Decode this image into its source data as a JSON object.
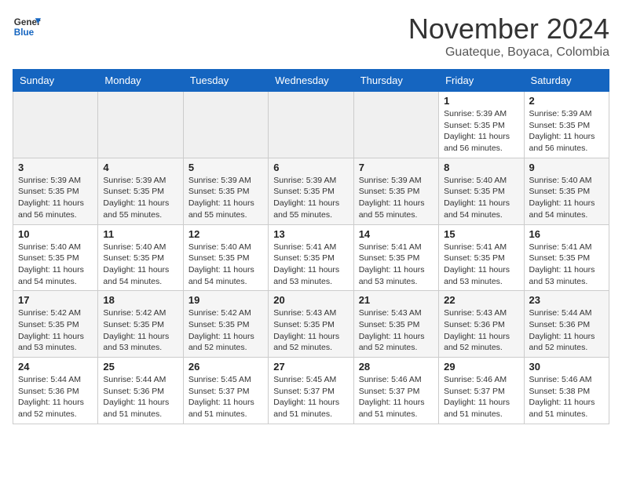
{
  "header": {
    "logo_line1": "General",
    "logo_line2": "Blue",
    "month": "November 2024",
    "location": "Guateque, Boyaca, Colombia"
  },
  "weekdays": [
    "Sunday",
    "Monday",
    "Tuesday",
    "Wednesday",
    "Thursday",
    "Friday",
    "Saturday"
  ],
  "weeks": [
    [
      {
        "day": "",
        "info": ""
      },
      {
        "day": "",
        "info": ""
      },
      {
        "day": "",
        "info": ""
      },
      {
        "day": "",
        "info": ""
      },
      {
        "day": "",
        "info": ""
      },
      {
        "day": "1",
        "info": "Sunrise: 5:39 AM\nSunset: 5:35 PM\nDaylight: 11 hours and 56 minutes."
      },
      {
        "day": "2",
        "info": "Sunrise: 5:39 AM\nSunset: 5:35 PM\nDaylight: 11 hours and 56 minutes."
      }
    ],
    [
      {
        "day": "3",
        "info": "Sunrise: 5:39 AM\nSunset: 5:35 PM\nDaylight: 11 hours and 56 minutes."
      },
      {
        "day": "4",
        "info": "Sunrise: 5:39 AM\nSunset: 5:35 PM\nDaylight: 11 hours and 55 minutes."
      },
      {
        "day": "5",
        "info": "Sunrise: 5:39 AM\nSunset: 5:35 PM\nDaylight: 11 hours and 55 minutes."
      },
      {
        "day": "6",
        "info": "Sunrise: 5:39 AM\nSunset: 5:35 PM\nDaylight: 11 hours and 55 minutes."
      },
      {
        "day": "7",
        "info": "Sunrise: 5:39 AM\nSunset: 5:35 PM\nDaylight: 11 hours and 55 minutes."
      },
      {
        "day": "8",
        "info": "Sunrise: 5:40 AM\nSunset: 5:35 PM\nDaylight: 11 hours and 54 minutes."
      },
      {
        "day": "9",
        "info": "Sunrise: 5:40 AM\nSunset: 5:35 PM\nDaylight: 11 hours and 54 minutes."
      }
    ],
    [
      {
        "day": "10",
        "info": "Sunrise: 5:40 AM\nSunset: 5:35 PM\nDaylight: 11 hours and 54 minutes."
      },
      {
        "day": "11",
        "info": "Sunrise: 5:40 AM\nSunset: 5:35 PM\nDaylight: 11 hours and 54 minutes."
      },
      {
        "day": "12",
        "info": "Sunrise: 5:40 AM\nSunset: 5:35 PM\nDaylight: 11 hours and 54 minutes."
      },
      {
        "day": "13",
        "info": "Sunrise: 5:41 AM\nSunset: 5:35 PM\nDaylight: 11 hours and 53 minutes."
      },
      {
        "day": "14",
        "info": "Sunrise: 5:41 AM\nSunset: 5:35 PM\nDaylight: 11 hours and 53 minutes."
      },
      {
        "day": "15",
        "info": "Sunrise: 5:41 AM\nSunset: 5:35 PM\nDaylight: 11 hours and 53 minutes."
      },
      {
        "day": "16",
        "info": "Sunrise: 5:41 AM\nSunset: 5:35 PM\nDaylight: 11 hours and 53 minutes."
      }
    ],
    [
      {
        "day": "17",
        "info": "Sunrise: 5:42 AM\nSunset: 5:35 PM\nDaylight: 11 hours and 53 minutes."
      },
      {
        "day": "18",
        "info": "Sunrise: 5:42 AM\nSunset: 5:35 PM\nDaylight: 11 hours and 53 minutes."
      },
      {
        "day": "19",
        "info": "Sunrise: 5:42 AM\nSunset: 5:35 PM\nDaylight: 11 hours and 52 minutes."
      },
      {
        "day": "20",
        "info": "Sunrise: 5:43 AM\nSunset: 5:35 PM\nDaylight: 11 hours and 52 minutes."
      },
      {
        "day": "21",
        "info": "Sunrise: 5:43 AM\nSunset: 5:35 PM\nDaylight: 11 hours and 52 minutes."
      },
      {
        "day": "22",
        "info": "Sunrise: 5:43 AM\nSunset: 5:36 PM\nDaylight: 11 hours and 52 minutes."
      },
      {
        "day": "23",
        "info": "Sunrise: 5:44 AM\nSunset: 5:36 PM\nDaylight: 11 hours and 52 minutes."
      }
    ],
    [
      {
        "day": "24",
        "info": "Sunrise: 5:44 AM\nSunset: 5:36 PM\nDaylight: 11 hours and 52 minutes."
      },
      {
        "day": "25",
        "info": "Sunrise: 5:44 AM\nSunset: 5:36 PM\nDaylight: 11 hours and 51 minutes."
      },
      {
        "day": "26",
        "info": "Sunrise: 5:45 AM\nSunset: 5:37 PM\nDaylight: 11 hours and 51 minutes."
      },
      {
        "day": "27",
        "info": "Sunrise: 5:45 AM\nSunset: 5:37 PM\nDaylight: 11 hours and 51 minutes."
      },
      {
        "day": "28",
        "info": "Sunrise: 5:46 AM\nSunset: 5:37 PM\nDaylight: 11 hours and 51 minutes."
      },
      {
        "day": "29",
        "info": "Sunrise: 5:46 AM\nSunset: 5:37 PM\nDaylight: 11 hours and 51 minutes."
      },
      {
        "day": "30",
        "info": "Sunrise: 5:46 AM\nSunset: 5:38 PM\nDaylight: 11 hours and 51 minutes."
      }
    ]
  ]
}
